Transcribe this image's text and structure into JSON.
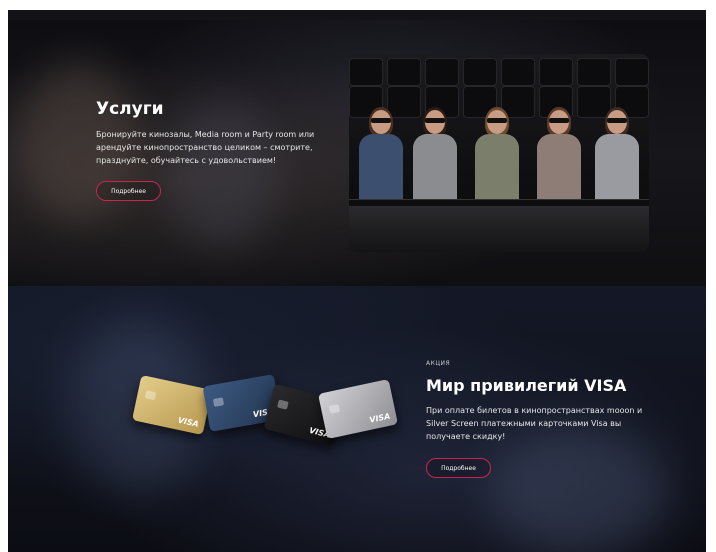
{
  "services": {
    "title": "Услуги",
    "description_line1": "Бронируйте кинозалы, Media room и Party room или",
    "description_line2": "арендуйте кинопространство целиком – смотрите,",
    "description_line3": "празднуйте, обучайтесь с удовольствием!",
    "button_label": "Подробнее"
  },
  "promo": {
    "tag": "АКЦИЯ",
    "title": "Мир привилегий VISA",
    "description_line1": "При оплате билетов в кинопространствах mooon и",
    "description_line2": "Silver Screen платежными карточками Visa вы",
    "description_line3": "получаете скидку!",
    "button_label": "Подробнее",
    "card_logo": "VISA"
  },
  "colors": {
    "accent": "#c8254f",
    "card_gold": "#cbb06a",
    "card_navy": "#2f4566",
    "card_black": "#1c1c1f",
    "card_silver": "#b8b8bc"
  }
}
